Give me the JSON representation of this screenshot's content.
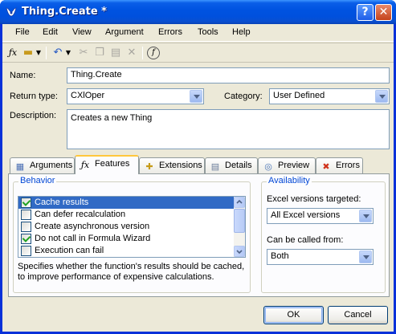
{
  "window": {
    "title": "Thing.Create *",
    "help_btn": "?",
    "close_btn": "✕"
  },
  "menu": [
    "File",
    "Edit",
    "View",
    "Argument",
    "Errors",
    "Tools",
    "Help"
  ],
  "form": {
    "name_label": "Name:",
    "name_value": "Thing.Create",
    "return_type_label": "Return type:",
    "return_type_value": "CXlOper",
    "category_label": "Category:",
    "category_value": "User Defined",
    "description_label": "Description:",
    "description_value": "Creates a new Thing"
  },
  "tabs": [
    {
      "label": "Arguments",
      "icon": "arguments-icon"
    },
    {
      "label": "Features",
      "icon": "fx-icon"
    },
    {
      "label": "Extensions",
      "icon": "extensions-icon"
    },
    {
      "label": "Details",
      "icon": "details-icon"
    },
    {
      "label": "Preview",
      "icon": "preview-icon"
    },
    {
      "label": "Errors",
      "icon": "errors-icon"
    }
  ],
  "active_tab": "Features",
  "behavior": {
    "title": "Behavior",
    "items": [
      {
        "label": "Cache results",
        "checked": true,
        "selected": true
      },
      {
        "label": "Can defer recalculation",
        "checked": false,
        "selected": false
      },
      {
        "label": "Create asynchronous version",
        "checked": false,
        "selected": false
      },
      {
        "label": "Do not call in Formula Wizard",
        "checked": true,
        "selected": false
      },
      {
        "label": "Execution can fail",
        "checked": false,
        "selected": false
      }
    ],
    "description": "Specifies whether the function's results should be cached, to improve performance of expensive calculations."
  },
  "availability": {
    "title": "Availability",
    "excel_label": "Excel versions targeted:",
    "excel_value": "All Excel versions",
    "called_label": "Can be called from:",
    "called_value": "Both"
  },
  "buttons": {
    "ok": "OK",
    "cancel": "Cancel"
  },
  "colors": {
    "title_bar": "#0053e1",
    "selection": "#316ac5",
    "group_title": "#0046d5",
    "active_tab_highlight": "#ffc73c"
  }
}
